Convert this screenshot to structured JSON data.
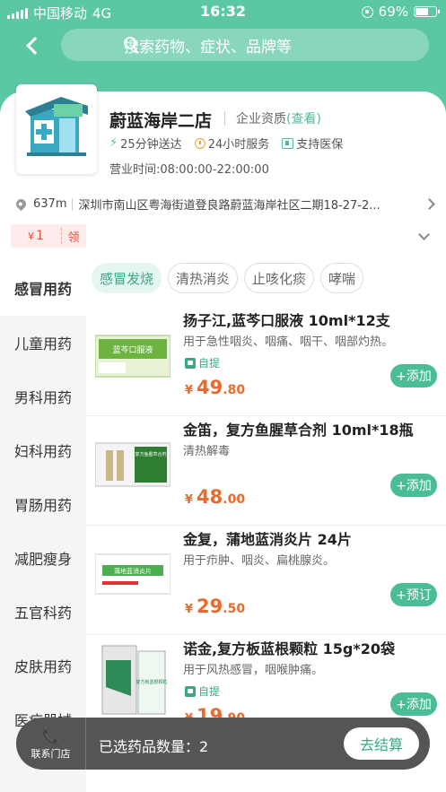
{
  "status_bar": {
    "carrier": "中国移动",
    "network": "4G",
    "time": "16:32",
    "battery": "69%",
    "battery_level": 0.69
  },
  "search": {
    "placeholder": "搜索药物、症状、品牌等"
  },
  "store": {
    "name": "蔚蓝海岸二店",
    "qualification_label": "企业资质",
    "qualification_link": "(查看)",
    "tags": [
      "25分钟送达",
      "24小时服务",
      "支持医保"
    ],
    "hours": "营业时间:08:00:00-22:00:00",
    "distance": "637m",
    "address": "深圳市南山区粤海街道登良路蔚蓝海岸社区二期18-27-2..."
  },
  "coupon": {
    "currency": "¥",
    "amount": "1",
    "action": "领"
  },
  "sidebar": {
    "items": [
      {
        "label": "感冒用药",
        "active": true
      },
      {
        "label": "儿童用药"
      },
      {
        "label": "男科用药"
      },
      {
        "label": "妇科用药"
      },
      {
        "label": "胃肠用药"
      },
      {
        "label": "减肥瘦身"
      },
      {
        "label": "五官科药"
      },
      {
        "label": "皮肤用药"
      },
      {
        "label": "医疗器械"
      }
    ]
  },
  "chips": [
    {
      "label": "感冒发烧",
      "active": true
    },
    {
      "label": "清热消炎"
    },
    {
      "label": "止咳化痰"
    },
    {
      "label": "哮喘"
    }
  ],
  "products": [
    {
      "name": "扬子江,蓝芩口服液 10ml*12支",
      "desc": "用于急性咽炎、咽痛、咽干、咽部灼热。",
      "pickup": "自提",
      "currency": "¥",
      "price_int": "49",
      "price_dec": ".80",
      "action": "+添加"
    },
    {
      "name": "金笛，复方鱼腥草合剂 10ml*18瓶",
      "desc": "清热解毒",
      "pickup": "",
      "currency": "¥",
      "price_int": "48",
      "price_dec": ".00",
      "action": "+添加"
    },
    {
      "name": "金复，蒲地蓝消炎片 24片",
      "desc": "用于疖肿、咽炎、扁桃腺炎。",
      "pickup": "",
      "currency": "¥",
      "price_int": "29",
      "price_dec": ".50",
      "action": "+预订"
    },
    {
      "name": "诺金,复方板蓝根颗粒 15g*20袋",
      "desc": "用于风热感冒，咽喉肿痛。",
      "pickup": "自提",
      "currency": "¥",
      "price_int": "19",
      "price_dec": ".90",
      "action": "+添加"
    }
  ],
  "product_images": [
    {
      "box_text": "蓝芩口服液"
    },
    {
      "box_text": "复方鱼腥草合剂"
    },
    {
      "box_text": "蒲地蓝消炎片"
    },
    {
      "box_text": "复方板蓝根颗粒"
    }
  ],
  "bottom_bar": {
    "contact": "联系门店",
    "selected": "已选药品数量：2",
    "checkout": "去结算"
  },
  "colors": {
    "brand": "#5cc7a5",
    "accent": "#4bbd96",
    "price": "#e86a2d",
    "coupon": "#e5533b"
  }
}
